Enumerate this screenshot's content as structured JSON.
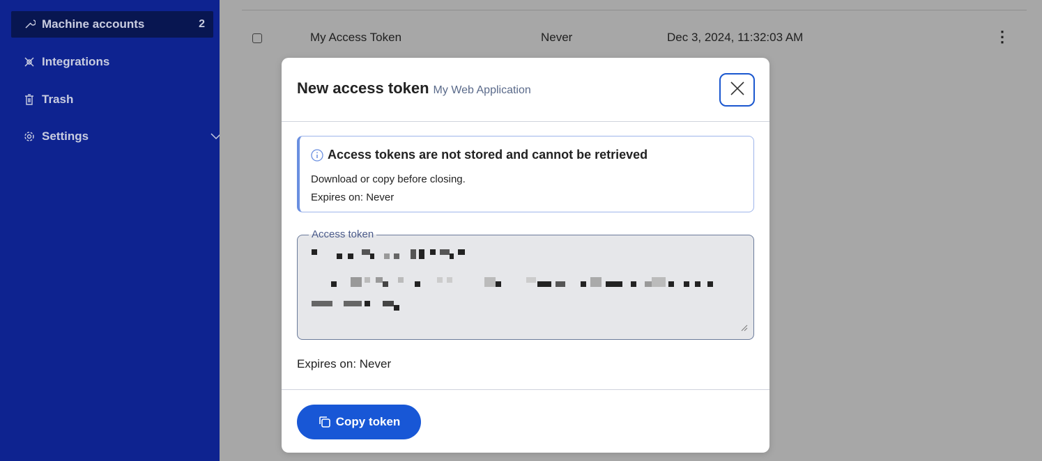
{
  "sidebar": {
    "items": [
      {
        "label": "Machine accounts",
        "count": "2",
        "icon": "wrench-icon",
        "active": true
      },
      {
        "label": "Integrations",
        "icon": "integrations-icon"
      },
      {
        "label": "Trash",
        "icon": "trash-icon"
      },
      {
        "label": "Settings",
        "icon": "gear-icon",
        "expandable": true
      }
    ]
  },
  "table": {
    "rows": [
      {
        "name": "My Access Token",
        "expires": "Never",
        "date": "Dec 3, 2024, 11:32:03 AM"
      }
    ]
  },
  "modal": {
    "title": "New access token",
    "subtitle": "My Web Application",
    "callout": {
      "title": "Access tokens are not stored and cannot be retrieved",
      "line1": "Download or copy before closing.",
      "line2": "Expires on: Never"
    },
    "token_label": "Access token",
    "expires_text": "Expires on: Never",
    "copy_button": "Copy token"
  },
  "colors": {
    "sidebar_bg": "#0e2390",
    "primary": "#1857d6",
    "overlay": "#a7a7a7"
  }
}
